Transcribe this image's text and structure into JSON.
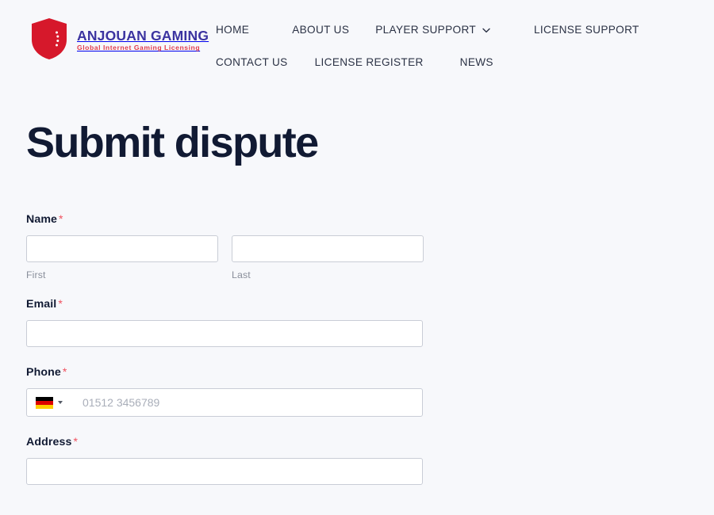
{
  "header": {
    "brand": {
      "shield_icon": "shield-crescent-icon",
      "wordmark": "ANJOUAN GAMING",
      "tagline": "Global Internet Gaming Licensing",
      "wordmark_color": "#3b33a0",
      "tagline_color": "#e03a4e",
      "shield_color": "#d6182b"
    },
    "nav": {
      "row_one": [
        {
          "label": "HOME",
          "has_dropdown": false
        },
        {
          "label": "ABOUT US",
          "has_dropdown": false
        },
        {
          "label": "PLAYER SUPPORT",
          "has_dropdown": true,
          "caret_icon": "chevron-down-icon"
        },
        {
          "label": "LICENSE SUPPORT",
          "has_dropdown": false
        }
      ],
      "row_two": [
        {
          "label": "CONTACT US",
          "has_dropdown": false
        },
        {
          "label": "LICENSE REGISTER",
          "has_dropdown": false
        },
        {
          "label": "NEWS",
          "has_dropdown": false
        }
      ]
    }
  },
  "main": {
    "title": "Submit dispute",
    "required_marker": "*",
    "form": {
      "name": {
        "label": "Name",
        "required": true,
        "first": {
          "value": "",
          "placeholder": "",
          "sublabel": "First"
        },
        "last": {
          "value": "",
          "placeholder": "",
          "sublabel": "Last"
        }
      },
      "email": {
        "label": "Email",
        "required": true,
        "value": "",
        "placeholder": ""
      },
      "phone": {
        "label": "Phone",
        "required": true,
        "value": "",
        "placeholder": "01512 3456789",
        "country_flag_icon": "flag-de-icon",
        "country_caret_icon": "caret-down-icon"
      },
      "address": {
        "label": "Address",
        "required": true,
        "value": "",
        "placeholder": ""
      }
    }
  },
  "theme": {
    "page_background": "#f7f8fb",
    "title_color": "#111a33",
    "nav_text_color": "#2b3245",
    "input_border": "#c9cdd6",
    "input_background": "#ffffff",
    "required_color": "#f0515f",
    "sublabel_color": "#8a8f9b"
  }
}
